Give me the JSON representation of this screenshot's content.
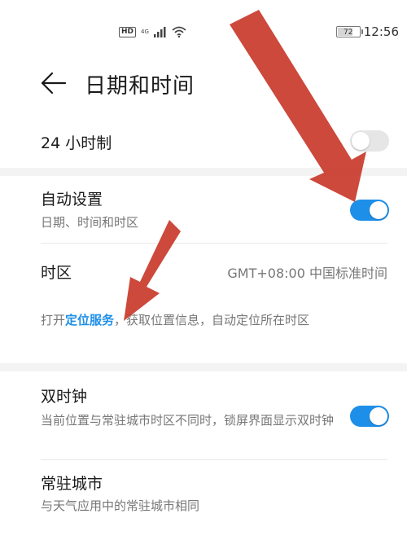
{
  "status_bar": {
    "hd": "HD",
    "network": "4G",
    "battery": "72",
    "battery_level": 0.72,
    "time": "12:56"
  },
  "header": {
    "title": "日期和时间"
  },
  "settings": {
    "hour24": {
      "label": "24 小时制",
      "enabled": false
    },
    "auto": {
      "label": "自动设置",
      "sub": "日期、时间和时区",
      "enabled": true
    },
    "timezone": {
      "label": "时区",
      "value": "GMT+08:00 中国标准时间",
      "hint_before": "打开",
      "hint_link": "定位服务",
      "hint_after": "，获取位置信息，自动定位所在时区"
    },
    "dual_clock": {
      "label": "双时钟",
      "sub": "当前位置与常驻城市时区不同时，锁屏界面显示双时钟",
      "enabled": true
    },
    "home_city": {
      "label": "常驻城市",
      "sub": "与天气应用中的常驻城市相同"
    }
  },
  "colors": {
    "accent": "#1e8fe8",
    "annotation_arrow": "#c83a2a"
  }
}
